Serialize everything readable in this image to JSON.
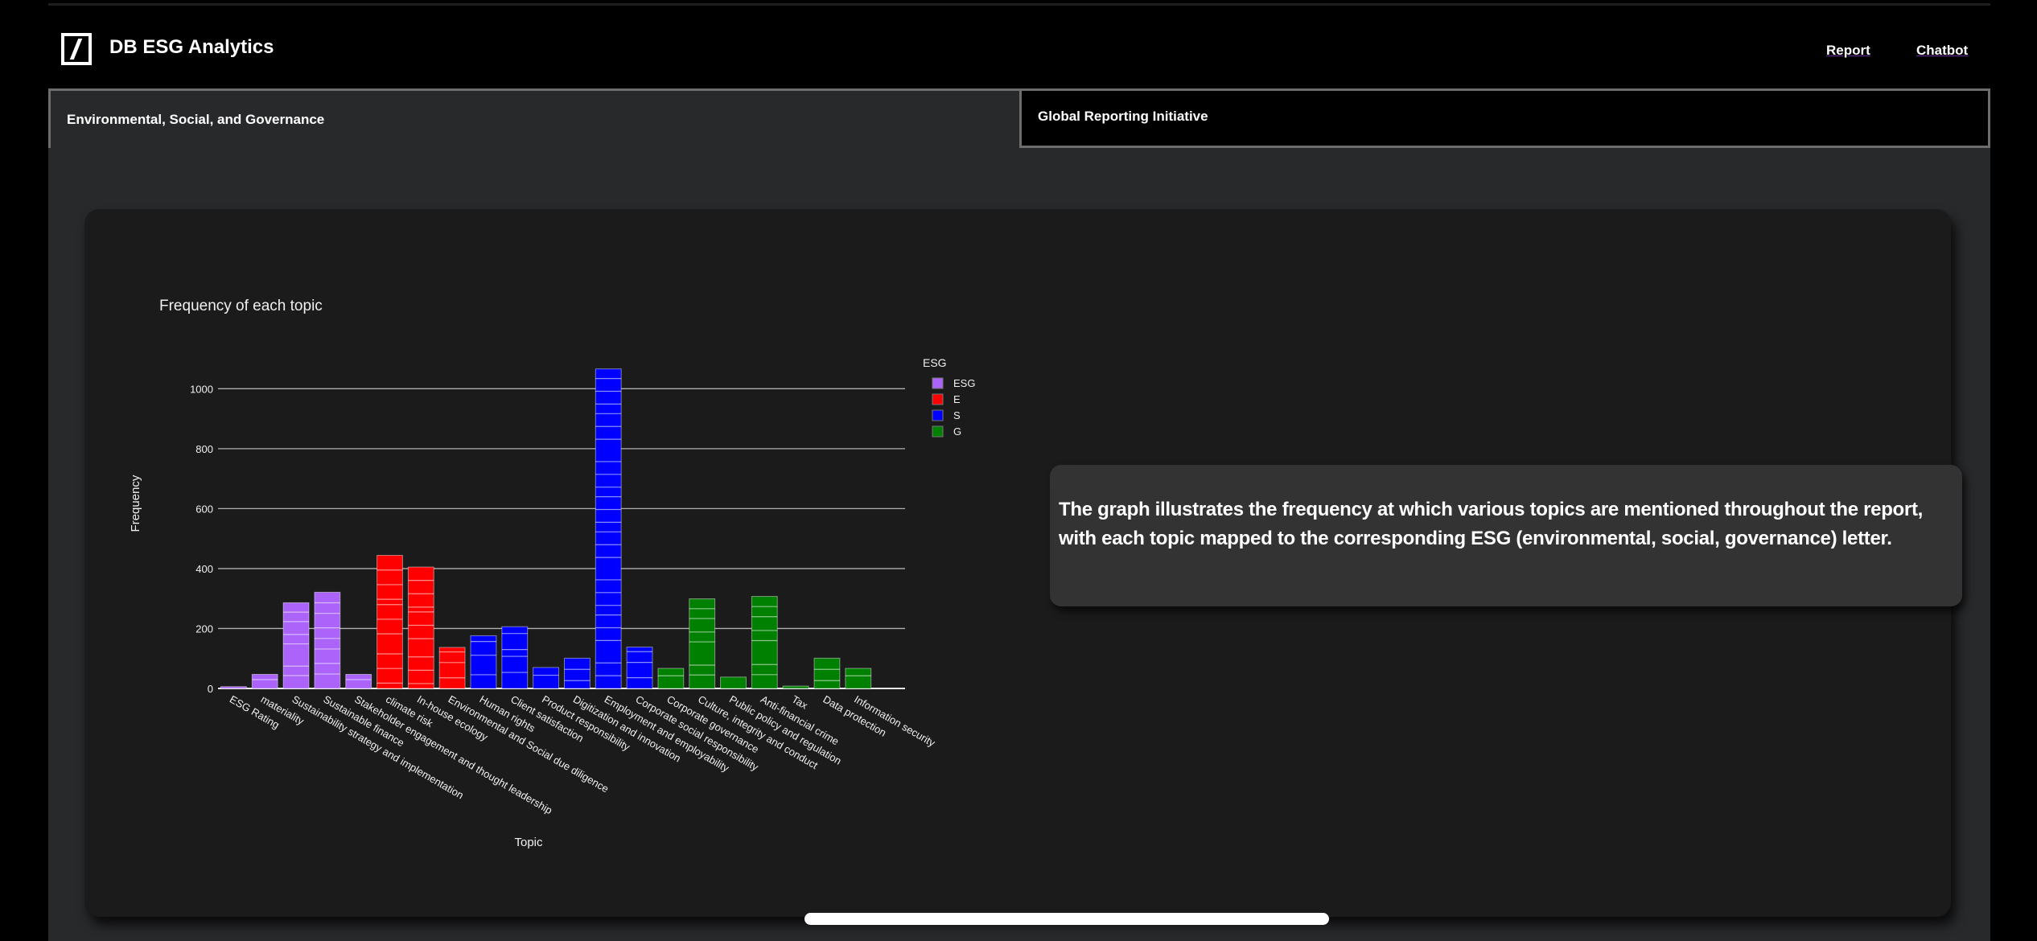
{
  "header": {
    "brand": "DB ESG Analytics",
    "logo_icon": "deutsche-bank-slash-logo",
    "nav": [
      {
        "label": "Report"
      },
      {
        "label": "Chatbot"
      }
    ]
  },
  "tabs": [
    {
      "label": "Environmental, Social, and Governance",
      "active": true
    },
    {
      "label": "Global Reporting Initiative",
      "active": false
    }
  ],
  "description": "The graph illustrates the frequency at which various topics are mentioned throughout the report, with each topic mapped to the corresponding ESG (environmental, social, governance) letter.",
  "colors": {
    "ESG": "#ab63fa",
    "E": "#ff0000",
    "S": "#0000ff",
    "G": "#008000",
    "background": "#1b1b1b",
    "gridline": "#b0b0b0"
  },
  "chart_data": {
    "type": "bar",
    "title": "Frequency of each topic",
    "xlabel": "Topic",
    "ylabel": "Frequency",
    "ylim": [
      0,
      1100
    ],
    "yticks": [
      0,
      200,
      400,
      600,
      800,
      1000
    ],
    "grid": true,
    "legend": {
      "title": "ESG",
      "position": "top-right",
      "entries": [
        "ESG",
        "E",
        "S",
        "G"
      ]
    },
    "categories": [
      "ESG Rating",
      "materiality",
      "Sustainability strategy and implementation",
      "Sustainable finance",
      "Stakeholder engagement and thought leadership",
      "climate risk",
      "In-house ecology",
      "Environmental and Social due diligence",
      "Human rights",
      "Client satisfaction",
      "Product responsibility",
      "Digitization and innovation",
      "Employment and employability",
      "Corporate social responsibility",
      "Corporate governance",
      "Culture, integrity and conduct",
      "Public policy and regulation",
      "Anti-financial crime",
      "Tax",
      "Data protection",
      "Information security"
    ],
    "groups": [
      "ESG",
      "ESG",
      "ESG",
      "ESG",
      "ESG",
      "E",
      "E",
      "E",
      "S",
      "S",
      "S",
      "S",
      "S",
      "S",
      "G",
      "G",
      "G",
      "G",
      "G",
      "G",
      "G"
    ],
    "values": [
      6,
      47,
      286,
      321,
      47,
      444,
      405,
      137,
      176,
      206,
      70,
      101,
      1066,
      138,
      67,
      299,
      38,
      307,
      8,
      101,
      67
    ]
  }
}
